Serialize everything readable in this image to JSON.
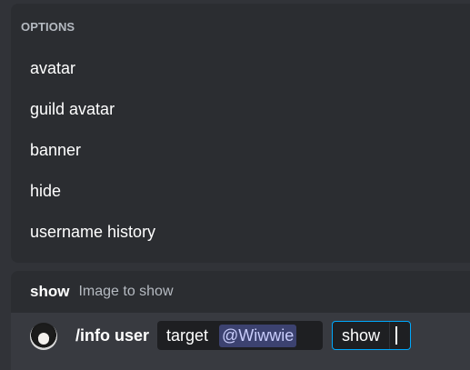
{
  "autocomplete": {
    "header": "OPTIONS",
    "items": [
      {
        "label": "avatar"
      },
      {
        "label": "guild avatar"
      },
      {
        "label": "banner"
      },
      {
        "label": "hide"
      },
      {
        "label": "username history"
      }
    ]
  },
  "option_hint": {
    "name": "show",
    "description": "Image to show"
  },
  "composer": {
    "command": "/info user",
    "target_label": "target",
    "target_value": "@Wiwwie",
    "show_label": "show"
  },
  "colors": {
    "background": "#313338",
    "panel": "#2b2d31",
    "chip": "#1e1f22",
    "mention_bg": "#3c4270",
    "mention_text": "#c9cdfb",
    "focus_border": "#00a8fc"
  },
  "icons": {
    "avatar": "user-avatar-image"
  }
}
